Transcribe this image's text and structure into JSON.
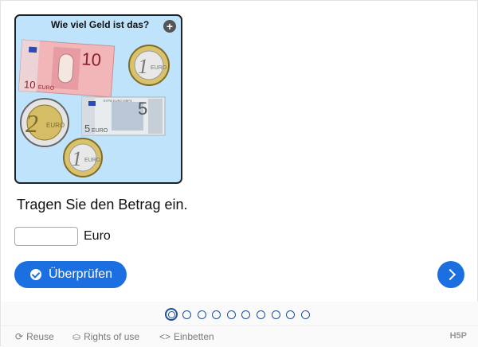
{
  "card": {
    "title": "Wie viel Geld ist das?"
  },
  "task": {
    "prompt": "Tragen Sie den Betrag ein."
  },
  "answer": {
    "value": "",
    "unit": "Euro"
  },
  "buttons": {
    "check": "Überprüfen"
  },
  "notes": {
    "ten": {
      "value": "10",
      "label": "EURO"
    },
    "five": {
      "value": "5",
      "label": "EURO",
      "top_text": "ΕΥΡΩ  EURO  ЕВРО"
    }
  },
  "coins": {
    "one": {
      "value": "1",
      "label": "EURO"
    },
    "two": {
      "value": "2",
      "label": "EURO"
    }
  },
  "pagination": {
    "total": 10,
    "current": 1
  },
  "footer": {
    "reuse": "Reuse",
    "rights": "Rights of use",
    "embed": "Einbetten",
    "brand": "H5P"
  },
  "colors": {
    "accent": "#1b6fe0",
    "card_bg": "#bfe3fb"
  }
}
